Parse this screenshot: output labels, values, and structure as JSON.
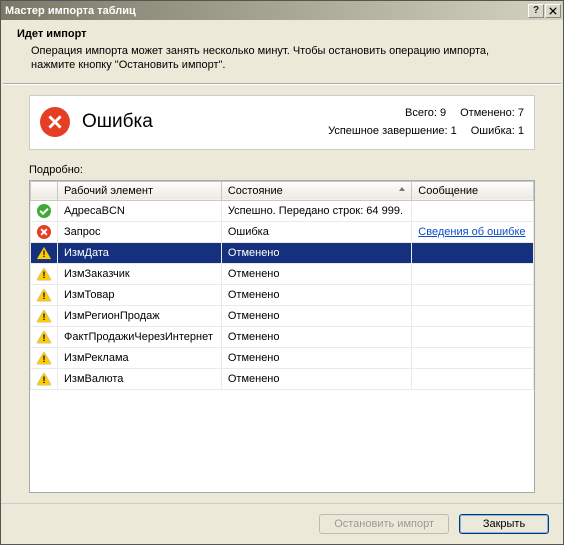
{
  "window": {
    "title": "Мастер импорта таблиц"
  },
  "header": {
    "title": "Идет импорт",
    "text": "Операция импорта может занять несколько минут. Чтобы остановить операцию импорта, нажмите кнопку \"Остановить импорт\"."
  },
  "status": {
    "label": "Ошибка",
    "total_label": "Всего:",
    "total_value": "9",
    "cancelled_label": "Отменено:",
    "cancelled_value": "7",
    "success_label": "Успешное завершение:",
    "success_value": "1",
    "error_label": "Ошибка:",
    "error_value": "1"
  },
  "details_label": "Подробно:",
  "columns": {
    "item": "Рабочий элемент",
    "state": "Состояние",
    "message": "Сообщение"
  },
  "rows": [
    {
      "icon": "success",
      "item": "АдресаBCN",
      "state": "Успешно. Передано строк: 64 999.",
      "message": ""
    },
    {
      "icon": "error",
      "item": "Запрос",
      "state": "Ошибка",
      "message": "Сведения об ошибке",
      "message_link": true
    },
    {
      "icon": "warn",
      "item": "ИзмДата",
      "state": "Отменено",
      "message": "",
      "selected": true
    },
    {
      "icon": "warn",
      "item": "ИзмЗаказчик",
      "state": "Отменено",
      "message": ""
    },
    {
      "icon": "warn",
      "item": "ИзмТовар",
      "state": "Отменено",
      "message": ""
    },
    {
      "icon": "warn",
      "item": "ИзмРегионПродаж",
      "state": "Отменено",
      "message": ""
    },
    {
      "icon": "warn",
      "item": "ФактПродажиЧерезИнтернет",
      "state": "Отменено",
      "message": ""
    },
    {
      "icon": "warn",
      "item": "ИзмРеклама",
      "state": "Отменено",
      "message": ""
    },
    {
      "icon": "warn",
      "item": "ИзмВалюта",
      "state": "Отменено",
      "message": ""
    }
  ],
  "footer": {
    "stop": "Остановить импорт",
    "close": "Закрыть"
  }
}
